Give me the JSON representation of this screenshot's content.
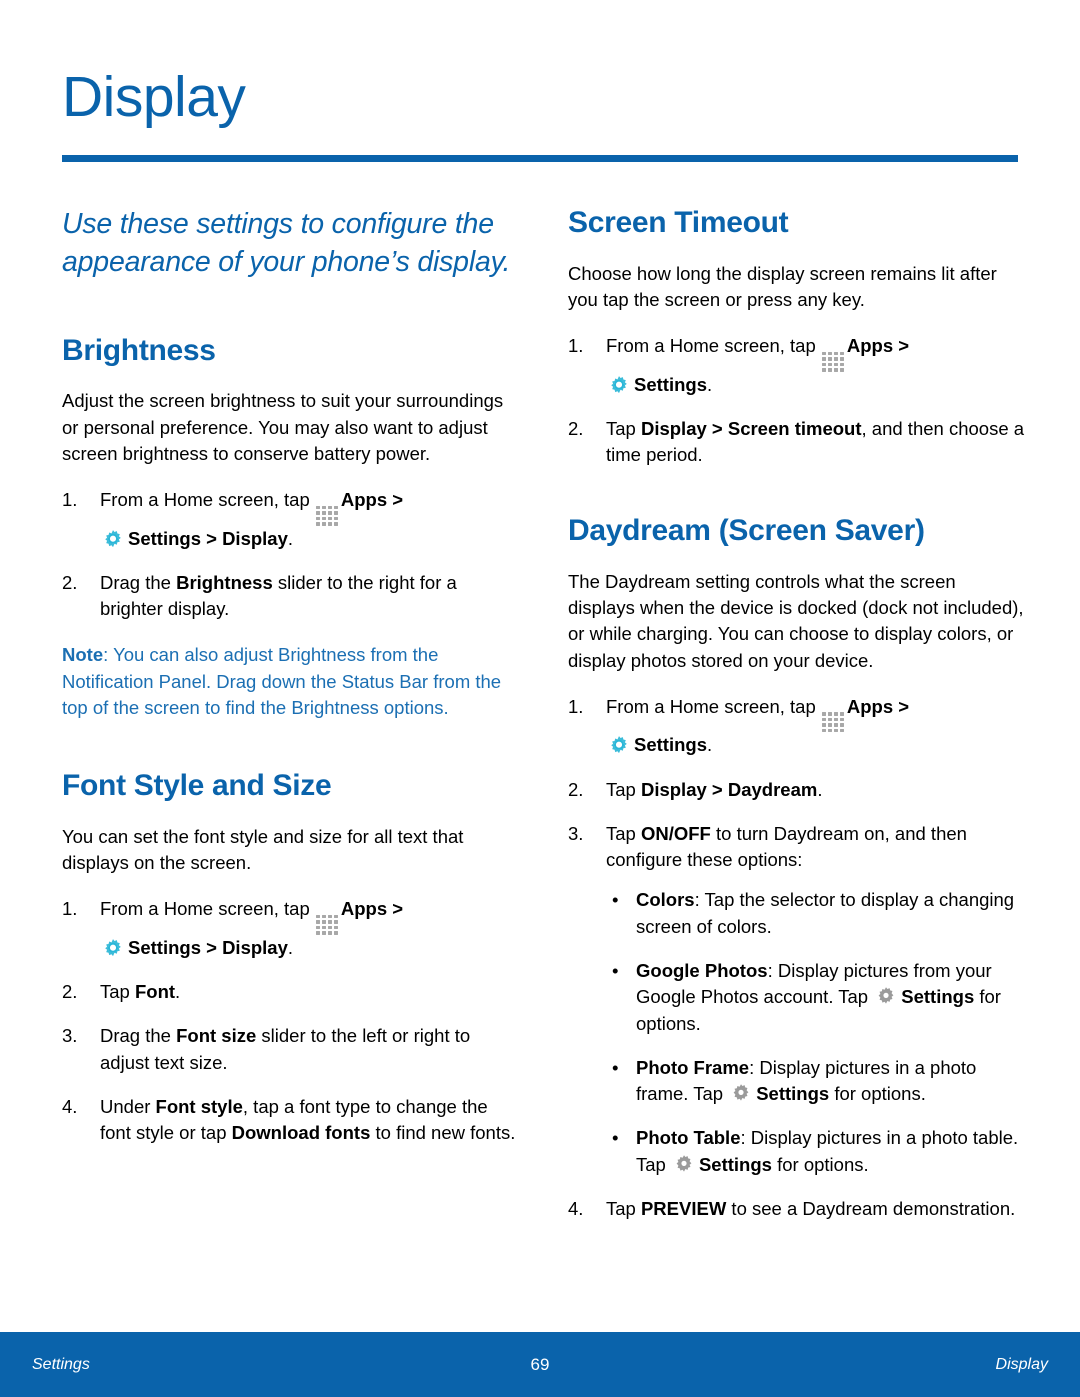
{
  "header": {
    "title": "Display"
  },
  "colors": {
    "brand_blue": "#0a63ab",
    "note_blue": "#1b6fb3",
    "gear_cyan": "#3bbcd9",
    "apps_gray": "#a8a8a8",
    "gear_gray": "#9b9b9b"
  },
  "left_column": {
    "lede": "Use these settings to configure the appearance of your phone’s display.",
    "brightness": {
      "heading": "Brightness",
      "intro": "Adjust the screen brightness to suit your surroundings or personal preference. You may also want to adjust screen brightness to conserve battery power.",
      "steps": [
        {
          "num": "1.",
          "pre": "From a Home screen, tap ",
          "apps_icon": "apps-grid-icon",
          "apps_label": "Apps",
          "sep": " > ",
          "gear_icon": "settings-gear-icon",
          "settings_label": "Settings",
          "post_bold": " > Display",
          "post": "."
        },
        {
          "num": "2.",
          "text_pre": "Drag the ",
          "bold": "Brightness",
          "text_post": " slider to the right for a brighter display."
        }
      ],
      "note_label": "Note",
      "note_text": ": You can also adjust Brightness from the Notification Panel. Drag down the Status Bar from the top of the screen to find the Brightness options."
    },
    "font_style": {
      "heading": "Font Style and Size",
      "intro": "You can set the font style and size for all text that displays on the screen.",
      "steps": [
        {
          "num": "1.",
          "pre": "From a Home screen, tap ",
          "apps_label": "Apps",
          "sep": " > ",
          "settings_label": "Settings",
          "post_bold": " > Display",
          "post": "."
        },
        {
          "num": "2.",
          "text_pre": "Tap ",
          "bold": "Font",
          "text_post": "."
        },
        {
          "num": "3.",
          "text_pre": "Drag the ",
          "bold": "Font size",
          "text_post": " slider to the left or right to adjust text size."
        },
        {
          "num": "4.",
          "text_pre": "Under ",
          "bold": "Font style",
          "text_mid": ", tap a font type to change the font style or tap ",
          "bold2": "Download fonts",
          "text_post": " to find new fonts."
        }
      ]
    }
  },
  "right_column": {
    "screen_timeout": {
      "heading": "Screen Timeout",
      "intro": "Choose how long the display screen remains lit after you tap the screen or press any key.",
      "steps": [
        {
          "num": "1.",
          "pre": "From a Home screen, tap ",
          "apps_label": "Apps",
          "sep": " > ",
          "settings_label": "Settings",
          "post": "."
        },
        {
          "num": "2.",
          "text_pre": "Tap ",
          "bold": "Display > Screen timeout",
          "text_post": ", and then choose a time period."
        }
      ]
    },
    "daydream": {
      "heading": "Daydream (Screen Saver)",
      "intro": "The Daydream setting controls what the screen displays when the device is docked (dock not included), or while charging. You can choose to display colors, or display photos stored on your device.",
      "steps": [
        {
          "num": "1.",
          "pre": "From a Home screen, tap ",
          "apps_label": "Apps",
          "sep": " > ",
          "settings_label": "Settings",
          "post": "."
        },
        {
          "num": "2.",
          "text_pre": "Tap ",
          "bold": "Display > Daydream",
          "text_post": "."
        },
        {
          "num": "3.",
          "text_pre": "Tap ",
          "bold": "ON/OFF",
          "text_post": " to turn Daydream on, and then configure these options:"
        },
        {
          "num": "4.",
          "text_pre": "Tap ",
          "bold": "PREVIEW",
          "text_post": " to see a Daydream demonstration."
        }
      ],
      "bullets": [
        {
          "dot": "•",
          "bold": "Colors",
          "text": ": Tap the selector to display a changing screen of colors."
        },
        {
          "dot": "•",
          "bold": "Google Photos",
          "text_pre": ": Display pictures from your Google Photos account. Tap ",
          "gear_icon": "settings-gear-gray-icon",
          "settings_label": "Settings",
          "text_post": " for options."
        },
        {
          "dot": "•",
          "bold": "Photo Frame",
          "text_pre": ": Display pictures in a photo frame. Tap ",
          "settings_label": "Settings",
          "text_post": " for options."
        },
        {
          "dot": "•",
          "bold": "Photo Table",
          "text_pre": ": Display pictures in a photo table. Tap ",
          "settings_label": "Settings",
          "text_post": " for options."
        }
      ]
    }
  },
  "footer": {
    "left": "Settings",
    "page_number": "69",
    "right": "Display"
  }
}
